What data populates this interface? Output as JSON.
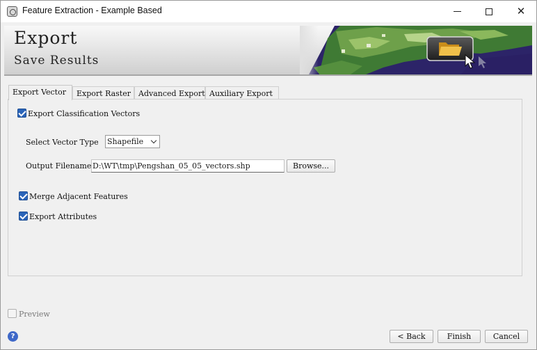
{
  "window": {
    "title": "Feature Extraction - Example Based",
    "controls": {
      "minimize": "minimize-icon",
      "maximize": "maximize-icon",
      "close": "close-icon",
      "close_glyph": "✕"
    }
  },
  "banner": {
    "title": "Export",
    "subtitle": "Save Results",
    "image": "satellite-folder-banner"
  },
  "tabs": [
    {
      "label": "Export Vector",
      "active": true
    },
    {
      "label": "Export Raster",
      "active": false
    },
    {
      "label": "Advanced Export",
      "active": false
    },
    {
      "label": "Auxiliary Export",
      "active": false
    }
  ],
  "export_vector": {
    "export_classification": {
      "label": "Export Classification Vectors",
      "checked": true
    },
    "vector_type": {
      "label": "Select Vector Type",
      "value": "Shapefile"
    },
    "output_filename": {
      "label": "Output Filename",
      "value": "D:\\WT\\tmp\\Pengshan_05_05_vectors.shp"
    },
    "browse_label": "Browse...",
    "merge_adjacent": {
      "label": "Merge Adjacent Features",
      "checked": true
    },
    "export_attributes": {
      "label": "Export Attributes",
      "checked": true
    }
  },
  "footer": {
    "preview": {
      "label": "Preview",
      "checked": false
    },
    "help_glyph": "?",
    "back_label": "< Back",
    "finish_label": "Finish",
    "cancel_label": "Cancel"
  },
  "colors": {
    "accent": "#2a64b8",
    "help": "#3e68c8",
    "banner_water": "#3a2a78",
    "banner_land": "#4f8a3a"
  }
}
